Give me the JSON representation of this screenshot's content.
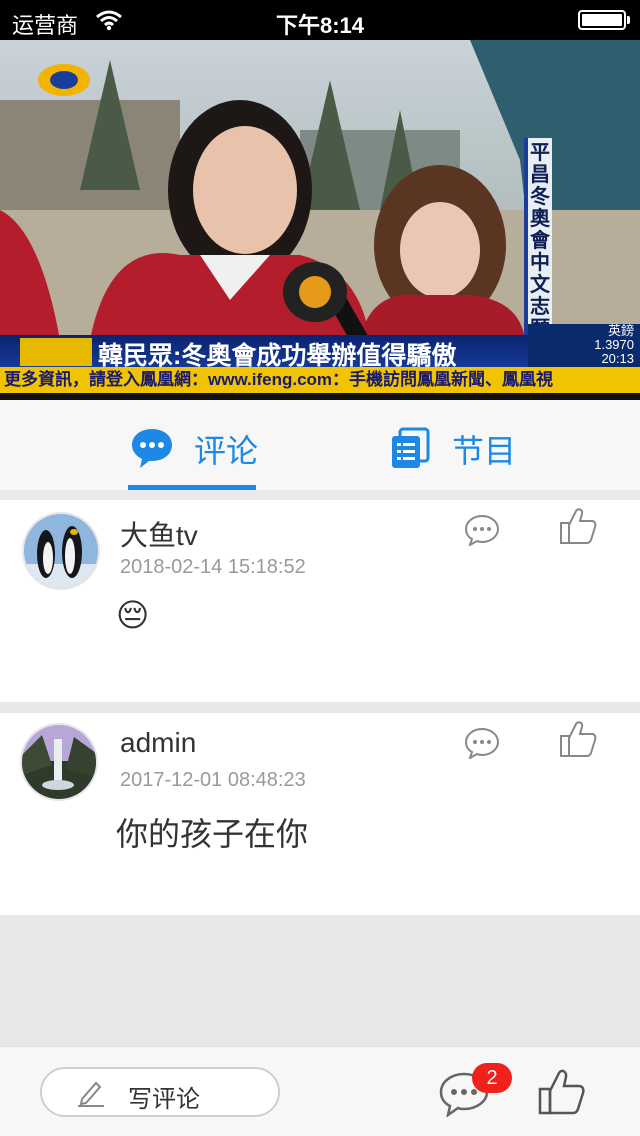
{
  "status_bar": {
    "carrier": "运营商",
    "time": "下午8:14"
  },
  "video": {
    "vertical_caption": "平昌冬奧會中文志願者",
    "headline": "韓民眾:冬奧會成功舉辦值得驕傲",
    "market": {
      "currency": "英鎊",
      "rate": "1.3970",
      "clock": "20:13"
    },
    "ticker": "更多資訊，請登入鳳凰網：www.ifeng.com：手機訪問鳳凰新聞、鳳凰視"
  },
  "tabs": [
    {
      "label": "评论",
      "icon": "comment-bubble-icon",
      "active": true
    },
    {
      "label": "节目",
      "icon": "program-list-icon",
      "active": false
    }
  ],
  "comments": [
    {
      "username": "大鱼tv",
      "time": "2018-02-14 15:18:52",
      "body": "😔",
      "avatar": "penguins-avatar"
    },
    {
      "username": "admin",
      "time": "2017-12-01 08:48:23",
      "body": "你的孩子在你",
      "avatar": "waterfall-avatar"
    }
  ],
  "bottom_bar": {
    "write_label": "写评论",
    "comment_badge": "2"
  },
  "colors": {
    "accent": "#1e88e5",
    "badge": "#f0201a"
  }
}
